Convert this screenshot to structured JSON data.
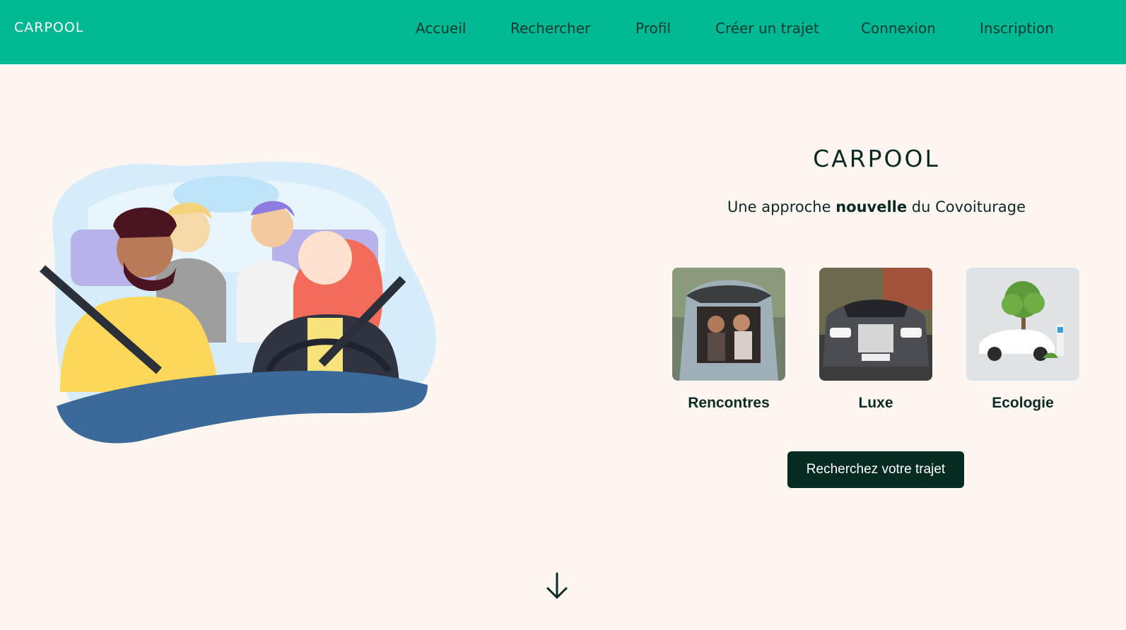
{
  "nav": {
    "logo": "CARPOOL",
    "items": [
      "Accueil",
      "Rechercher",
      "Profil",
      "Créer un trajet",
      "Connexion",
      "Inscription"
    ]
  },
  "hero": {
    "brand": "CARPOOL",
    "tagline_before": "Une approche ",
    "tagline_bold": "nouvelle",
    "tagline_after": " du Covoiturage",
    "cards": [
      {
        "label": "Rencontres",
        "image": "friends-in-car-trunk-photo"
      },
      {
        "label": "Luxe",
        "image": "luxury-car-photo"
      },
      {
        "label": "Ecologie",
        "image": "electric-car-tree-photo"
      }
    ],
    "cta": "Recherchez votre trajet"
  },
  "colors": {
    "nav_bg": "#00b894",
    "page_bg": "#fdf5f0",
    "cta_bg": "#062b23",
    "text": "#0b2a24"
  },
  "icons": {
    "scroll": "arrow-down-icon"
  }
}
